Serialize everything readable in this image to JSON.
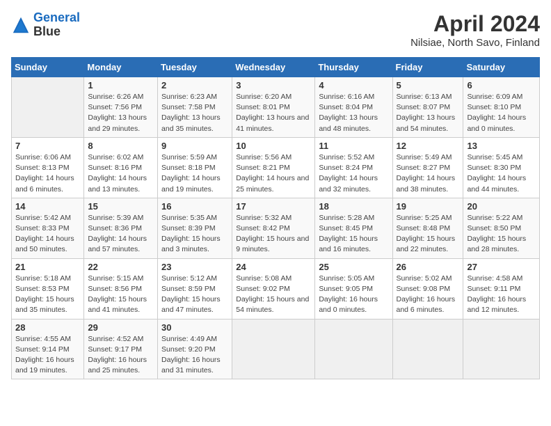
{
  "logo": {
    "line1": "General",
    "line2": "Blue"
  },
  "title": "April 2024",
  "subtitle": "Nilsiae, North Savo, Finland",
  "headers": [
    "Sunday",
    "Monday",
    "Tuesday",
    "Wednesday",
    "Thursday",
    "Friday",
    "Saturday"
  ],
  "rows": [
    [
      {
        "day": "",
        "sunrise": "",
        "sunset": "",
        "daylight": ""
      },
      {
        "day": "1",
        "sunrise": "Sunrise: 6:26 AM",
        "sunset": "Sunset: 7:56 PM",
        "daylight": "Daylight: 13 hours and 29 minutes."
      },
      {
        "day": "2",
        "sunrise": "Sunrise: 6:23 AM",
        "sunset": "Sunset: 7:58 PM",
        "daylight": "Daylight: 13 hours and 35 minutes."
      },
      {
        "day": "3",
        "sunrise": "Sunrise: 6:20 AM",
        "sunset": "Sunset: 8:01 PM",
        "daylight": "Daylight: 13 hours and 41 minutes."
      },
      {
        "day": "4",
        "sunrise": "Sunrise: 6:16 AM",
        "sunset": "Sunset: 8:04 PM",
        "daylight": "Daylight: 13 hours and 48 minutes."
      },
      {
        "day": "5",
        "sunrise": "Sunrise: 6:13 AM",
        "sunset": "Sunset: 8:07 PM",
        "daylight": "Daylight: 13 hours and 54 minutes."
      },
      {
        "day": "6",
        "sunrise": "Sunrise: 6:09 AM",
        "sunset": "Sunset: 8:10 PM",
        "daylight": "Daylight: 14 hours and 0 minutes."
      }
    ],
    [
      {
        "day": "7",
        "sunrise": "Sunrise: 6:06 AM",
        "sunset": "Sunset: 8:13 PM",
        "daylight": "Daylight: 14 hours and 6 minutes."
      },
      {
        "day": "8",
        "sunrise": "Sunrise: 6:02 AM",
        "sunset": "Sunset: 8:16 PM",
        "daylight": "Daylight: 14 hours and 13 minutes."
      },
      {
        "day": "9",
        "sunrise": "Sunrise: 5:59 AM",
        "sunset": "Sunset: 8:18 PM",
        "daylight": "Daylight: 14 hours and 19 minutes."
      },
      {
        "day": "10",
        "sunrise": "Sunrise: 5:56 AM",
        "sunset": "Sunset: 8:21 PM",
        "daylight": "Daylight: 14 hours and 25 minutes."
      },
      {
        "day": "11",
        "sunrise": "Sunrise: 5:52 AM",
        "sunset": "Sunset: 8:24 PM",
        "daylight": "Daylight: 14 hours and 32 minutes."
      },
      {
        "day": "12",
        "sunrise": "Sunrise: 5:49 AM",
        "sunset": "Sunset: 8:27 PM",
        "daylight": "Daylight: 14 hours and 38 minutes."
      },
      {
        "day": "13",
        "sunrise": "Sunrise: 5:45 AM",
        "sunset": "Sunset: 8:30 PM",
        "daylight": "Daylight: 14 hours and 44 minutes."
      }
    ],
    [
      {
        "day": "14",
        "sunrise": "Sunrise: 5:42 AM",
        "sunset": "Sunset: 8:33 PM",
        "daylight": "Daylight: 14 hours and 50 minutes."
      },
      {
        "day": "15",
        "sunrise": "Sunrise: 5:39 AM",
        "sunset": "Sunset: 8:36 PM",
        "daylight": "Daylight: 14 hours and 57 minutes."
      },
      {
        "day": "16",
        "sunrise": "Sunrise: 5:35 AM",
        "sunset": "Sunset: 8:39 PM",
        "daylight": "Daylight: 15 hours and 3 minutes."
      },
      {
        "day": "17",
        "sunrise": "Sunrise: 5:32 AM",
        "sunset": "Sunset: 8:42 PM",
        "daylight": "Daylight: 15 hours and 9 minutes."
      },
      {
        "day": "18",
        "sunrise": "Sunrise: 5:28 AM",
        "sunset": "Sunset: 8:45 PM",
        "daylight": "Daylight: 15 hours and 16 minutes."
      },
      {
        "day": "19",
        "sunrise": "Sunrise: 5:25 AM",
        "sunset": "Sunset: 8:48 PM",
        "daylight": "Daylight: 15 hours and 22 minutes."
      },
      {
        "day": "20",
        "sunrise": "Sunrise: 5:22 AM",
        "sunset": "Sunset: 8:50 PM",
        "daylight": "Daylight: 15 hours and 28 minutes."
      }
    ],
    [
      {
        "day": "21",
        "sunrise": "Sunrise: 5:18 AM",
        "sunset": "Sunset: 8:53 PM",
        "daylight": "Daylight: 15 hours and 35 minutes."
      },
      {
        "day": "22",
        "sunrise": "Sunrise: 5:15 AM",
        "sunset": "Sunset: 8:56 PM",
        "daylight": "Daylight: 15 hours and 41 minutes."
      },
      {
        "day": "23",
        "sunrise": "Sunrise: 5:12 AM",
        "sunset": "Sunset: 8:59 PM",
        "daylight": "Daylight: 15 hours and 47 minutes."
      },
      {
        "day": "24",
        "sunrise": "Sunrise: 5:08 AM",
        "sunset": "Sunset: 9:02 PM",
        "daylight": "Daylight: 15 hours and 54 minutes."
      },
      {
        "day": "25",
        "sunrise": "Sunrise: 5:05 AM",
        "sunset": "Sunset: 9:05 PM",
        "daylight": "Daylight: 16 hours and 0 minutes."
      },
      {
        "day": "26",
        "sunrise": "Sunrise: 5:02 AM",
        "sunset": "Sunset: 9:08 PM",
        "daylight": "Daylight: 16 hours and 6 minutes."
      },
      {
        "day": "27",
        "sunrise": "Sunrise: 4:58 AM",
        "sunset": "Sunset: 9:11 PM",
        "daylight": "Daylight: 16 hours and 12 minutes."
      }
    ],
    [
      {
        "day": "28",
        "sunrise": "Sunrise: 4:55 AM",
        "sunset": "Sunset: 9:14 PM",
        "daylight": "Daylight: 16 hours and 19 minutes."
      },
      {
        "day": "29",
        "sunrise": "Sunrise: 4:52 AM",
        "sunset": "Sunset: 9:17 PM",
        "daylight": "Daylight: 16 hours and 25 minutes."
      },
      {
        "day": "30",
        "sunrise": "Sunrise: 4:49 AM",
        "sunset": "Sunset: 9:20 PM",
        "daylight": "Daylight: 16 hours and 31 minutes."
      },
      {
        "day": "",
        "sunrise": "",
        "sunset": "",
        "daylight": ""
      },
      {
        "day": "",
        "sunrise": "",
        "sunset": "",
        "daylight": ""
      },
      {
        "day": "",
        "sunrise": "",
        "sunset": "",
        "daylight": ""
      },
      {
        "day": "",
        "sunrise": "",
        "sunset": "",
        "daylight": ""
      }
    ]
  ]
}
